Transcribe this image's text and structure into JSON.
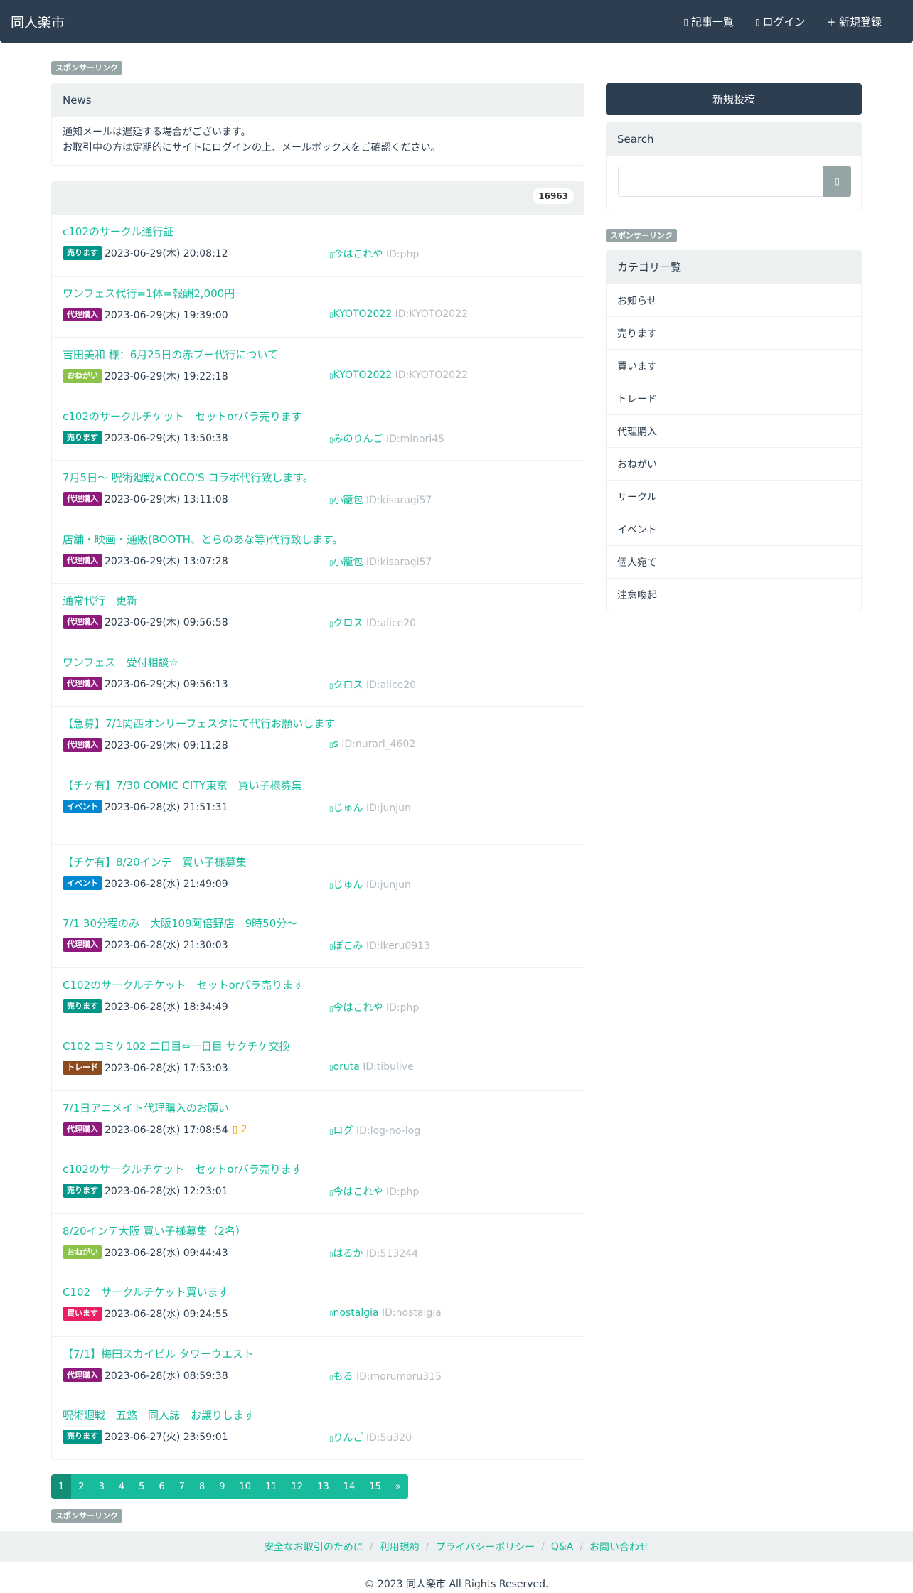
{
  "nav": {
    "brand": "同人楽市",
    "links": [
      {
        "label": "記事一覧",
        "icon": "list-icon"
      },
      {
        "label": "ログイン",
        "icon": "login-icon"
      },
      {
        "label": "+ 新規登録",
        "icon": ""
      }
    ]
  },
  "sponsor_label": "スポンサーリンク",
  "news": {
    "heading": "News",
    "lines": [
      "通知メールは遅延する場合がございます。",
      "お取引中の方は定期的にサイトにログインの上、メールボックスをご確認ください。"
    ]
  },
  "post_list": {
    "count": "16963",
    "posts": [
      {
        "title": "c102のサークル通行証",
        "tag": "売ります",
        "tag_color": "#009688",
        "date": "2023-06-29(木) 20:08:12",
        "replies": "",
        "user": "今はこれや",
        "uid": "ID:php"
      },
      {
        "title": "ワンフェス代行=1体=報酬2,000円",
        "tag": "代理購入",
        "tag_color": "#8e1a7c",
        "date": "2023-06-29(木) 19:39:00",
        "replies": "",
        "user": "KYOTO2022",
        "uid": "ID:KYOTO2022"
      },
      {
        "title": "吉田美和 様：6月25日の赤ブー代行について",
        "tag": "おねがい",
        "tag_color": "#8bc34a",
        "date": "2023-06-29(木) 19:22:18",
        "replies": "",
        "user": "KYOTO2022",
        "uid": "ID:KYOTO2022"
      },
      {
        "title": "c102のサークルチケット　セットorバラ売ります",
        "tag": "売ります",
        "tag_color": "#009688",
        "date": "2023-06-29(木) 13:50:38",
        "replies": "",
        "user": "みのりんご",
        "uid": "ID:minori45"
      },
      {
        "title": "7月5日～ 呪術廻戦×COCO'S コラボ代行致します。",
        "tag": "代理購入",
        "tag_color": "#8e1a7c",
        "date": "2023-06-29(木) 13:11:08",
        "replies": "",
        "user": "小籠包",
        "uid": "ID:kisaragi57"
      },
      {
        "title": "店舗・映画・通販(BOOTH、とらのあな等)代行致します。",
        "tag": "代理購入",
        "tag_color": "#8e1a7c",
        "date": "2023-06-29(木) 13:07:28",
        "replies": "",
        "user": "小籠包",
        "uid": "ID:kisaragi57"
      },
      {
        "title": "通常代行　更新",
        "tag": "代理購入",
        "tag_color": "#8e1a7c",
        "date": "2023-06-29(木) 09:56:58",
        "replies": "",
        "user": "クロス",
        "uid": "ID:alice20"
      },
      {
        "title": "ワンフェス　受付相談☆",
        "tag": "代理購入",
        "tag_color": "#8e1a7c",
        "date": "2023-06-29(木) 09:56:13",
        "replies": "",
        "user": "クロス",
        "uid": "ID:alice20"
      },
      {
        "title": "【急募】7/1関西オンリーフェスタにて代行お願いします",
        "tag": "代理購入",
        "tag_color": "#8e1a7c",
        "date": "2023-06-29(木) 09:11:28",
        "replies": "",
        "user": "s",
        "uid": "ID:nurari_4602"
      },
      {
        "title": "【チケ有】7/30 COMIC CITY東京　買い子様募集",
        "tag": "イベント",
        "tag_color": "#0288d1",
        "date": "2023-06-28(水) 21:51:31",
        "replies": "",
        "user": "じゅん",
        "uid": "ID:junjun",
        "gap": true
      },
      {
        "title": "【チケ有】8/20インテ　買い子様募集",
        "tag": "イベント",
        "tag_color": "#0288d1",
        "date": "2023-06-28(水) 21:49:09",
        "replies": "",
        "user": "じゅん",
        "uid": "ID:junjun"
      },
      {
        "title": "7/1 30分程のみ　大阪109阿倍野店　9時50分～",
        "tag": "代理購入",
        "tag_color": "#8e1a7c",
        "date": "2023-06-28(水) 21:30:03",
        "replies": "",
        "user": "ぽこみ",
        "uid": "ID:ikeru0913"
      },
      {
        "title": "C102のサークルチケット　セットorバラ売ります",
        "tag": "売ります",
        "tag_color": "#009688",
        "date": "2023-06-28(水) 18:34:49",
        "replies": "",
        "user": "今はこれや",
        "uid": "ID:php"
      },
      {
        "title": "C102 コミケ102 二日目⇔一日目 サクチケ交換",
        "tag": "トレード",
        "tag_color": "#8d4b22",
        "date": "2023-06-28(水) 17:53:03",
        "replies": "",
        "user": "oruta",
        "uid": "ID:tibulive"
      },
      {
        "title": "7/1日アニメイト代理購入のお願い",
        "tag": "代理購入",
        "tag_color": "#8e1a7c",
        "date": "2023-06-28(水) 17:08:54",
        "replies": "2",
        "user": "ログ",
        "uid": "ID:log-no-log"
      },
      {
        "title": "c102のサークルチケット　セットorバラ売ります",
        "tag": "売ります",
        "tag_color": "#009688",
        "date": "2023-06-28(水) 12:23:01",
        "replies": "",
        "user": "今はこれや",
        "uid": "ID:php"
      },
      {
        "title": "8/20インテ大阪 買い子様募集（2名）",
        "tag": "おねがい",
        "tag_color": "#8bc34a",
        "date": "2023-06-28(水) 09:44:43",
        "replies": "",
        "user": "はるか",
        "uid": "ID:513244"
      },
      {
        "title": "C102　サークルチケット買います",
        "tag": "買います",
        "tag_color": "#e91e63",
        "date": "2023-06-28(水) 09:24:55",
        "replies": "",
        "user": "nostalgia",
        "uid": "ID:nostalgia"
      },
      {
        "title": "【7/1】梅田スカイビル タワーウエスト",
        "tag": "代理購入",
        "tag_color": "#8e1a7c",
        "date": "2023-06-28(水) 08:59:38",
        "replies": "",
        "user": "もる",
        "uid": "ID:morumoru315"
      },
      {
        "title": "呪術廻戦　五悠　同人誌　お譲りします",
        "tag": "売ります",
        "tag_color": "#009688",
        "date": "2023-06-27(火) 23:59:01",
        "replies": "",
        "user": "りんご",
        "uid": "ID:5u320"
      }
    ]
  },
  "sidebar": {
    "new_post_label": "新規投稿",
    "search_heading": "Search",
    "search_value": "",
    "categories_heading": "カテゴリ一覧",
    "categories": [
      "お知らせ",
      "売ります",
      "買います",
      "トレード",
      "代理購入",
      "おねがい",
      "サークル",
      "イベント",
      "個人宛て",
      "注意喚起"
    ]
  },
  "pagination": {
    "current": "1",
    "pages": [
      "1",
      "2",
      "3",
      "4",
      "5",
      "6",
      "7",
      "8",
      "9",
      "10",
      "11",
      "12",
      "13",
      "14",
      "15",
      "»"
    ]
  },
  "footer": {
    "links": [
      "安全なお取引のために",
      "利用規約",
      "プライバシーポリシー",
      "Q&A",
      "お問い合わせ"
    ],
    "copyright": "© 2023 同人楽市 All Rights Reserved."
  },
  "colors": {
    "navbar": "#2c3e50",
    "accent": "#18bc9c",
    "muted": "#95a5a6"
  }
}
